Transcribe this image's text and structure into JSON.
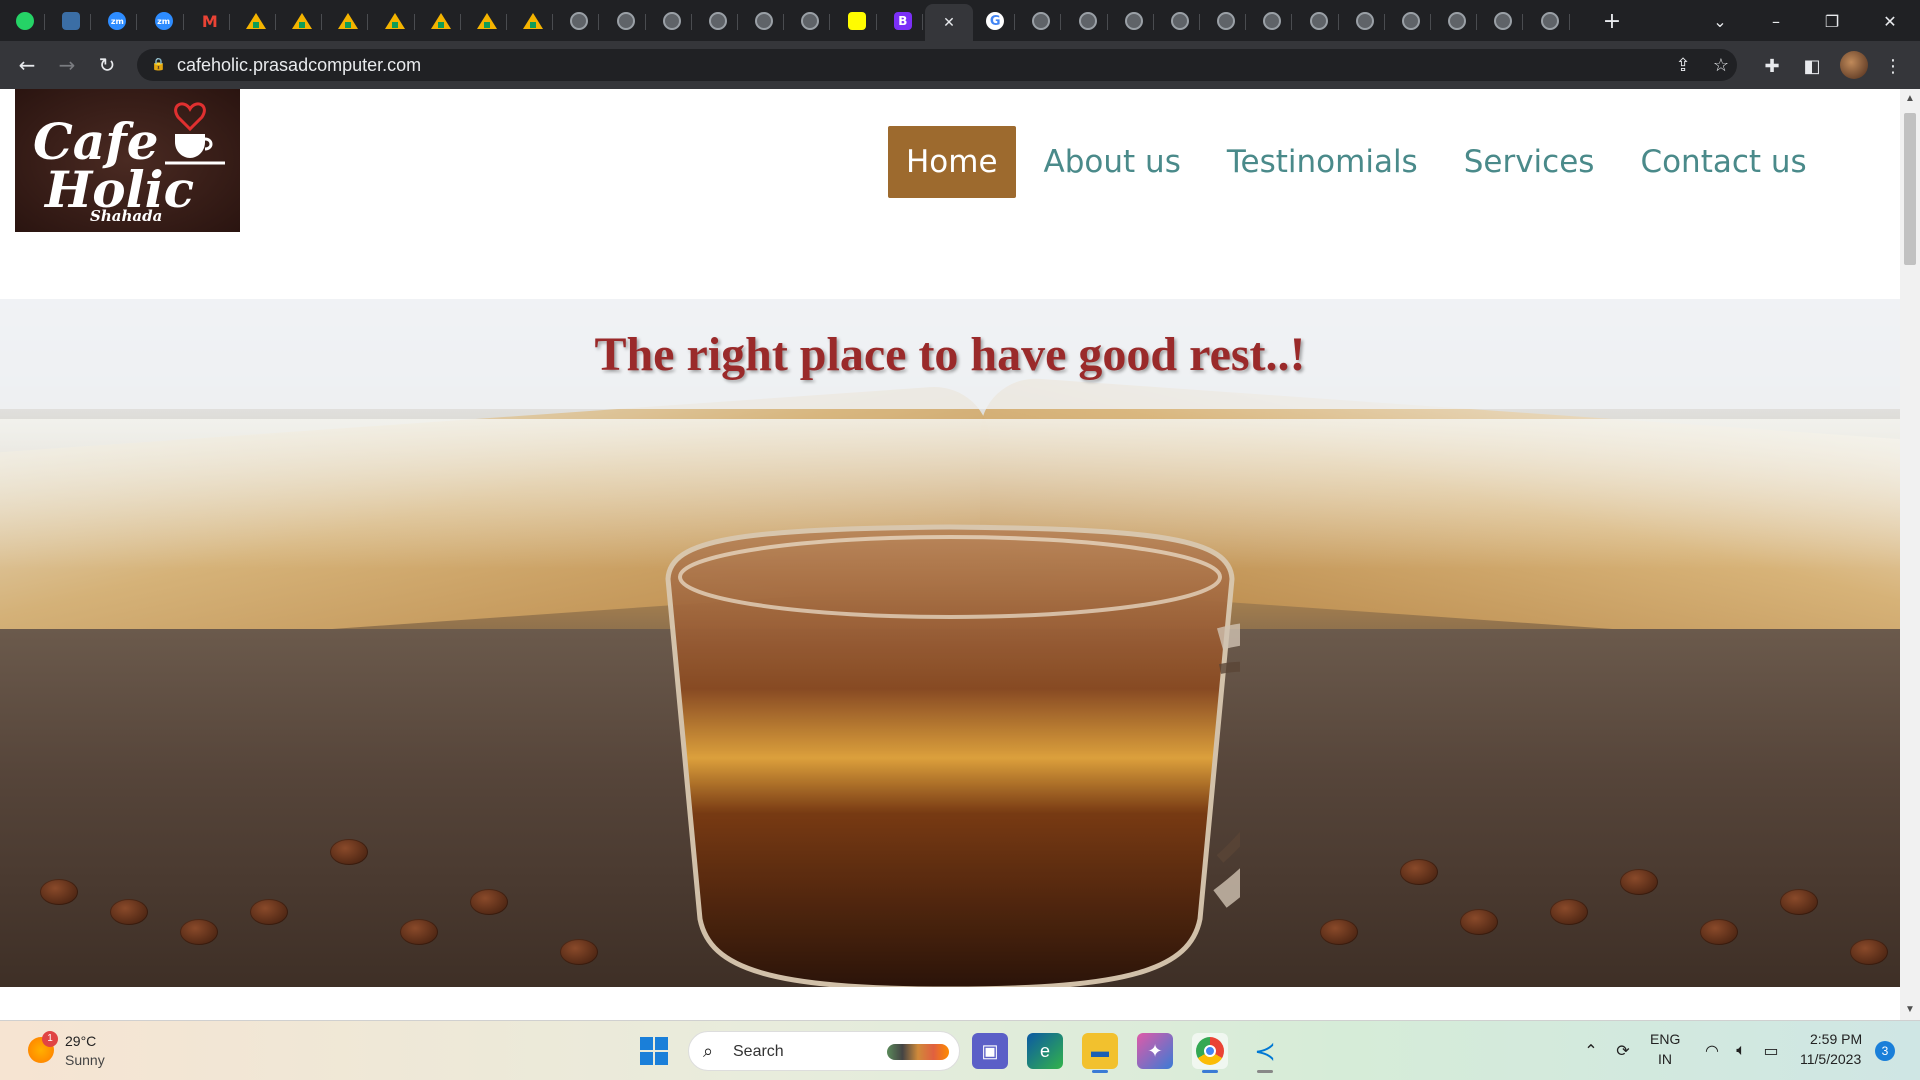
{
  "browser": {
    "url": "cafeholic.prasadcomputer.com",
    "tabs": [
      {
        "icon": "whatsapp-icon",
        "text": ""
      },
      {
        "icon": "app-icon",
        "text": ""
      },
      {
        "icon": "zoom-icon",
        "text": "zm"
      },
      {
        "icon": "zoom-icon",
        "text": "zm"
      },
      {
        "icon": "gmail-icon",
        "text": "M"
      },
      {
        "icon": "google-drive-icon",
        "text": ""
      },
      {
        "icon": "google-drive-icon",
        "text": ""
      },
      {
        "icon": "google-drive-icon",
        "text": ""
      },
      {
        "icon": "google-drive-icon",
        "text": ""
      },
      {
        "icon": "google-drive-icon",
        "text": ""
      },
      {
        "icon": "google-drive-icon",
        "text": ""
      },
      {
        "icon": "google-drive-icon",
        "text": ""
      },
      {
        "icon": "globe-icon",
        "text": ""
      },
      {
        "icon": "globe-icon",
        "text": ""
      },
      {
        "icon": "globe-icon",
        "text": ""
      },
      {
        "icon": "globe-icon",
        "text": ""
      },
      {
        "icon": "globe-icon",
        "text": ""
      },
      {
        "icon": "globe-icon",
        "text": ""
      },
      {
        "icon": "snapchat-icon",
        "text": ""
      },
      {
        "icon": "bootstrap-icon",
        "text": "B"
      },
      {
        "icon": "close-icon",
        "text": "✕",
        "active": true
      },
      {
        "icon": "google-icon",
        "text": "G"
      },
      {
        "icon": "globe-icon",
        "text": ""
      },
      {
        "icon": "globe-icon",
        "text": ""
      },
      {
        "icon": "globe-icon",
        "text": ""
      },
      {
        "icon": "globe-icon",
        "text": ""
      },
      {
        "icon": "globe-icon",
        "text": ""
      },
      {
        "icon": "globe-icon",
        "text": ""
      },
      {
        "icon": "globe-icon",
        "text": ""
      },
      {
        "icon": "globe-icon",
        "text": ""
      },
      {
        "icon": "globe-icon",
        "text": ""
      },
      {
        "icon": "globe-icon",
        "text": ""
      },
      {
        "icon": "globe-icon",
        "text": ""
      },
      {
        "icon": "globe-icon",
        "text": ""
      }
    ],
    "new_tab_label": "+"
  },
  "site": {
    "logo_title_line1": "Cafe",
    "logo_title_line2": "Holic",
    "logo_sub": "Shahada",
    "nav": [
      {
        "label": "Home",
        "active": true
      },
      {
        "label": "About us",
        "active": false
      },
      {
        "label": "Testinomials",
        "active": false
      },
      {
        "label": "Services",
        "active": false
      },
      {
        "label": "Contact us",
        "active": false
      }
    ],
    "tagline": "The right place to have good rest..!"
  },
  "colors": {
    "nav_active_bg": "#9d6a2e",
    "nav_link": "#4a8a8a",
    "tagline": "#9a2a2a"
  },
  "taskbar": {
    "weather_temp": "29°C",
    "weather_cond": "Sunny",
    "weather_badge": "1",
    "search_label": "Search",
    "lang_line1": "ENG",
    "lang_line2": "IN",
    "time": "2:59 PM",
    "date": "11/5/2023",
    "notifications": "3"
  }
}
